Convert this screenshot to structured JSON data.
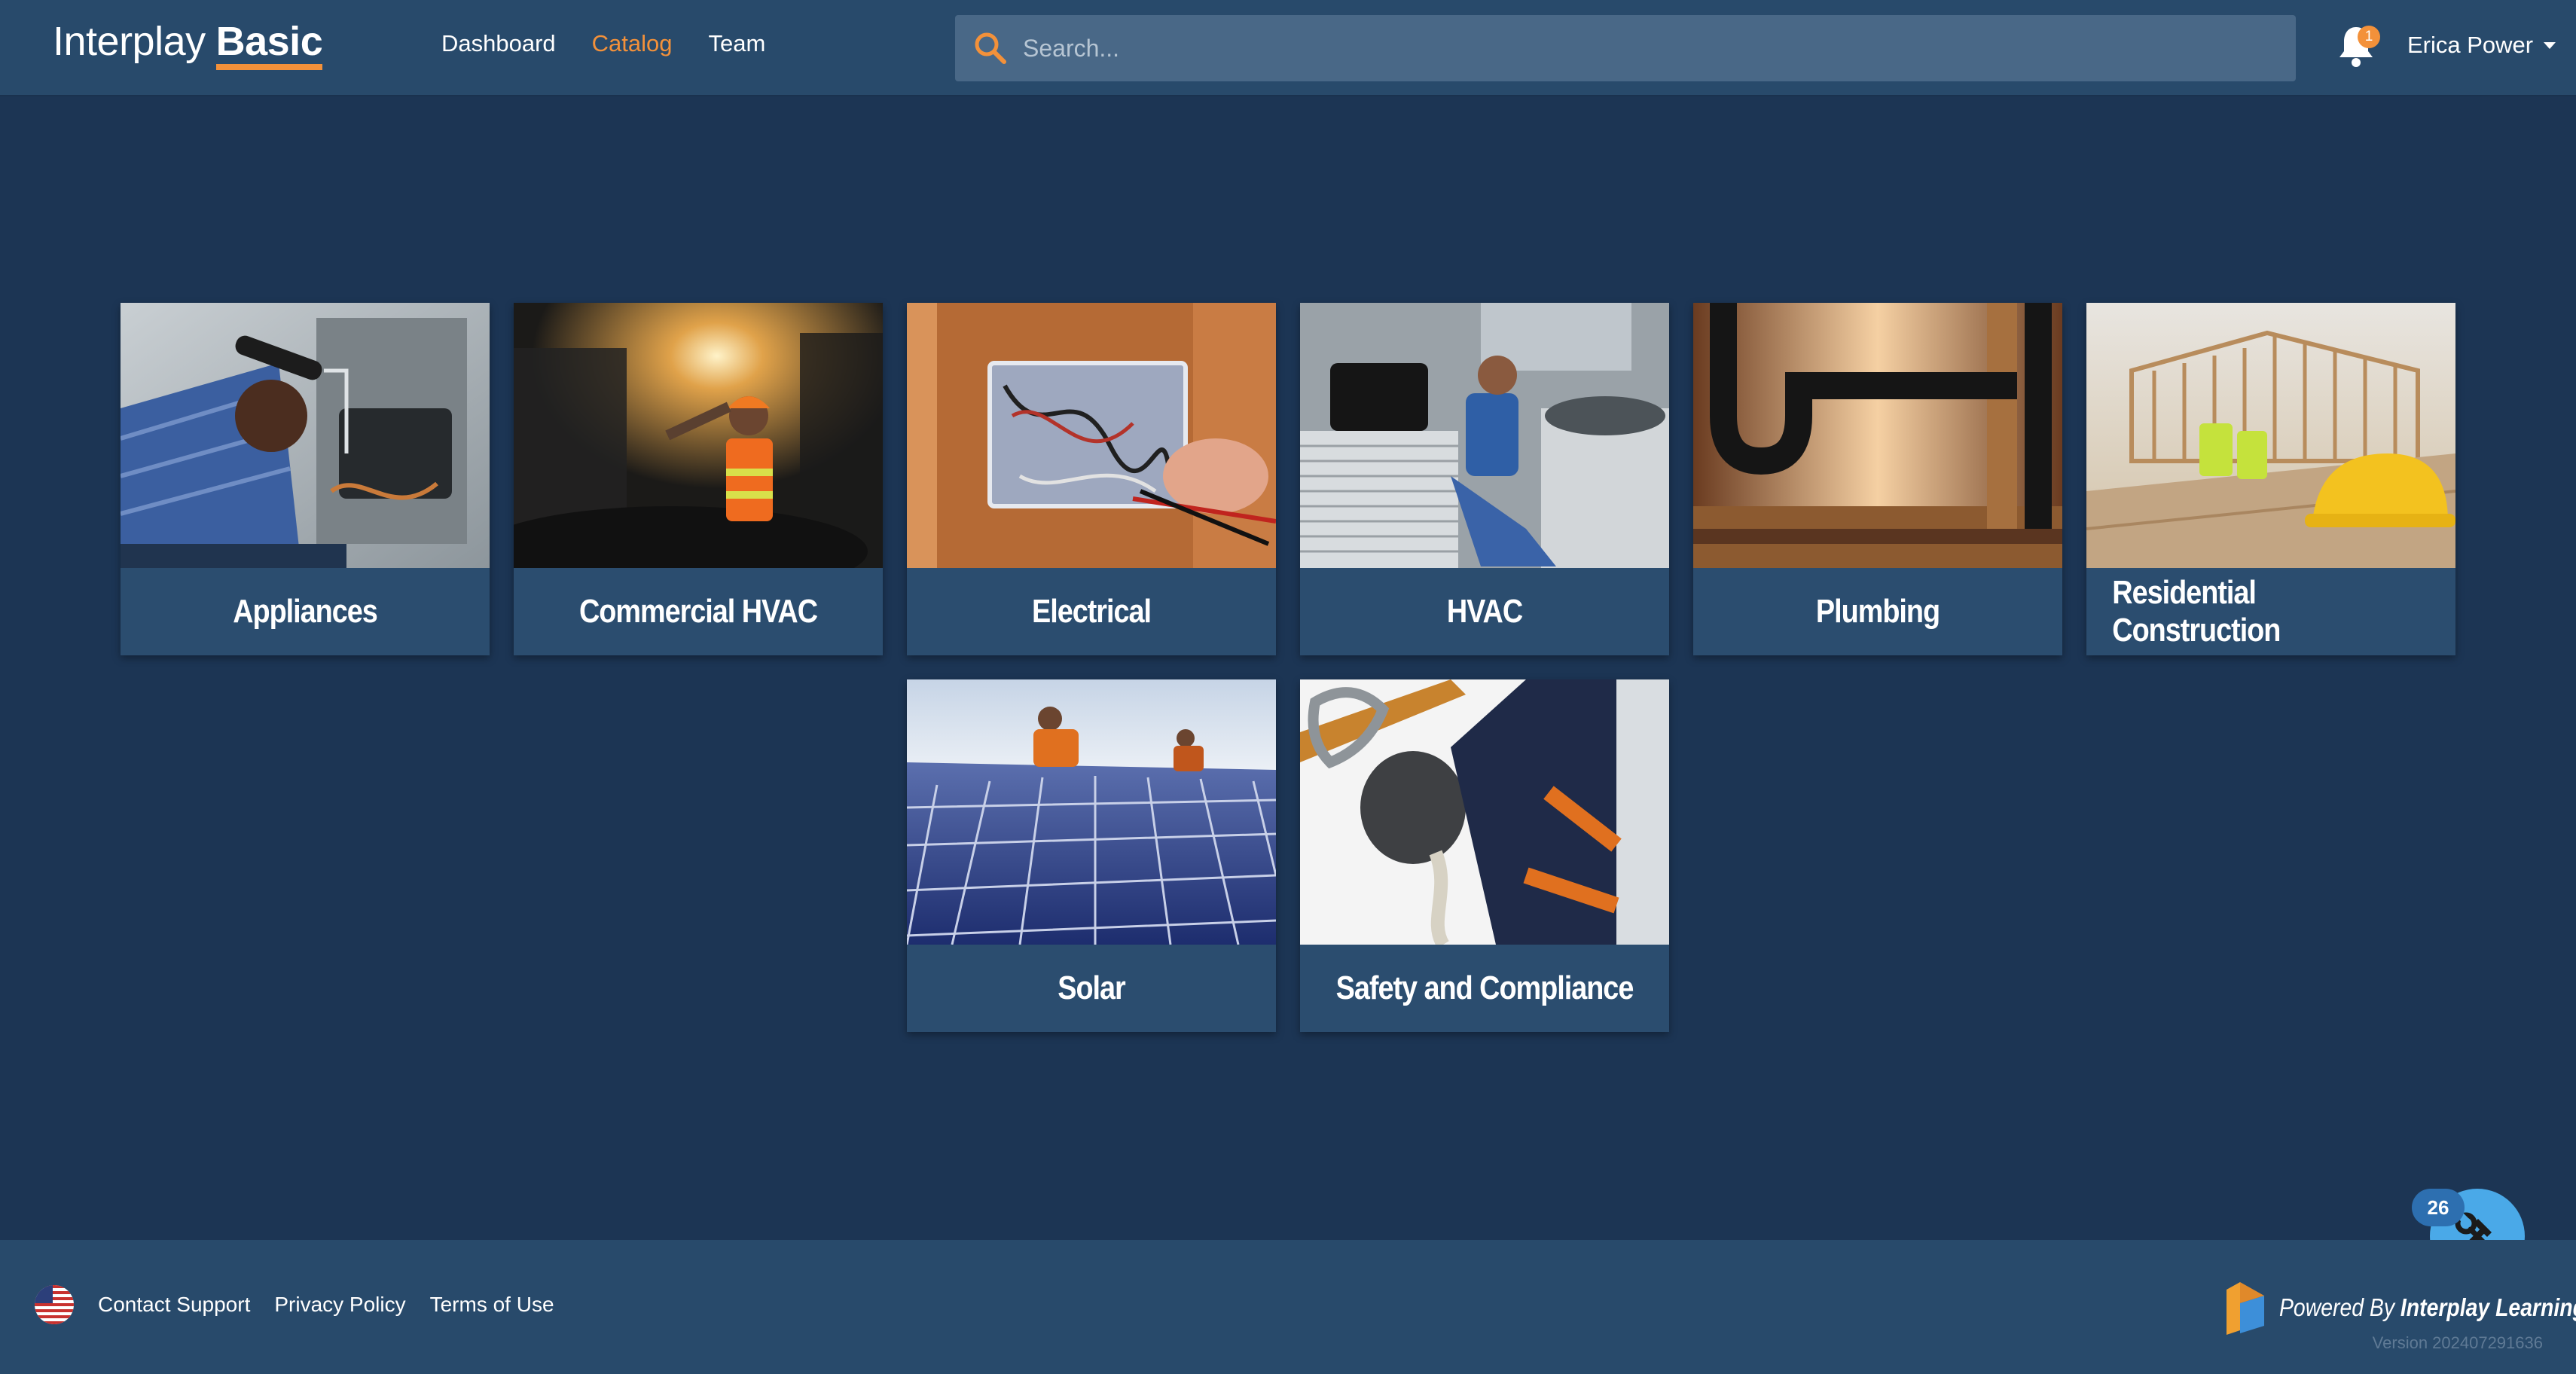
{
  "header": {
    "logo_plain": "Interplay",
    "logo_bold": "Basic",
    "nav": [
      {
        "label": "Dashboard",
        "active": false
      },
      {
        "label": "Catalog",
        "active": true
      },
      {
        "label": "Team",
        "active": false
      }
    ],
    "search_placeholder": "Search...",
    "notification_count": "1",
    "user_name": "Erica Power"
  },
  "catalog": {
    "cards": [
      {
        "title": "Appliances",
        "image": "technician-inspecting-appliance"
      },
      {
        "title": "Commercial HVAC",
        "image": "worker-in-mechanical-room"
      },
      {
        "title": "Electrical",
        "image": "hand-testing-junction-box"
      },
      {
        "title": "HVAC",
        "image": "technician-with-ac-units"
      },
      {
        "title": "Plumbing",
        "image": "black-drain-pipe"
      },
      {
        "title": "Residential Construction",
        "image": "house-framing-with-hardhat"
      },
      {
        "title": "Solar",
        "image": "workers-on-solar-panels"
      },
      {
        "title": "Safety and Compliance",
        "image": "fall-protection-harness"
      }
    ]
  },
  "footer": {
    "links": [
      "Contact Support",
      "Privacy Policy",
      "Terms of Use"
    ],
    "powered_by_prefix": "Powered By",
    "powered_by_brand": "Interplay Learning",
    "version": "Version 202407291636"
  },
  "tools": {
    "count": "26",
    "icon": "hammer-wrench-icon"
  },
  "colors": {
    "background": "#1c3554",
    "bar": "#284a6b",
    "accent": "#f3913a",
    "card": "#2b4d6f",
    "tools_button": "#4aa9e8"
  }
}
